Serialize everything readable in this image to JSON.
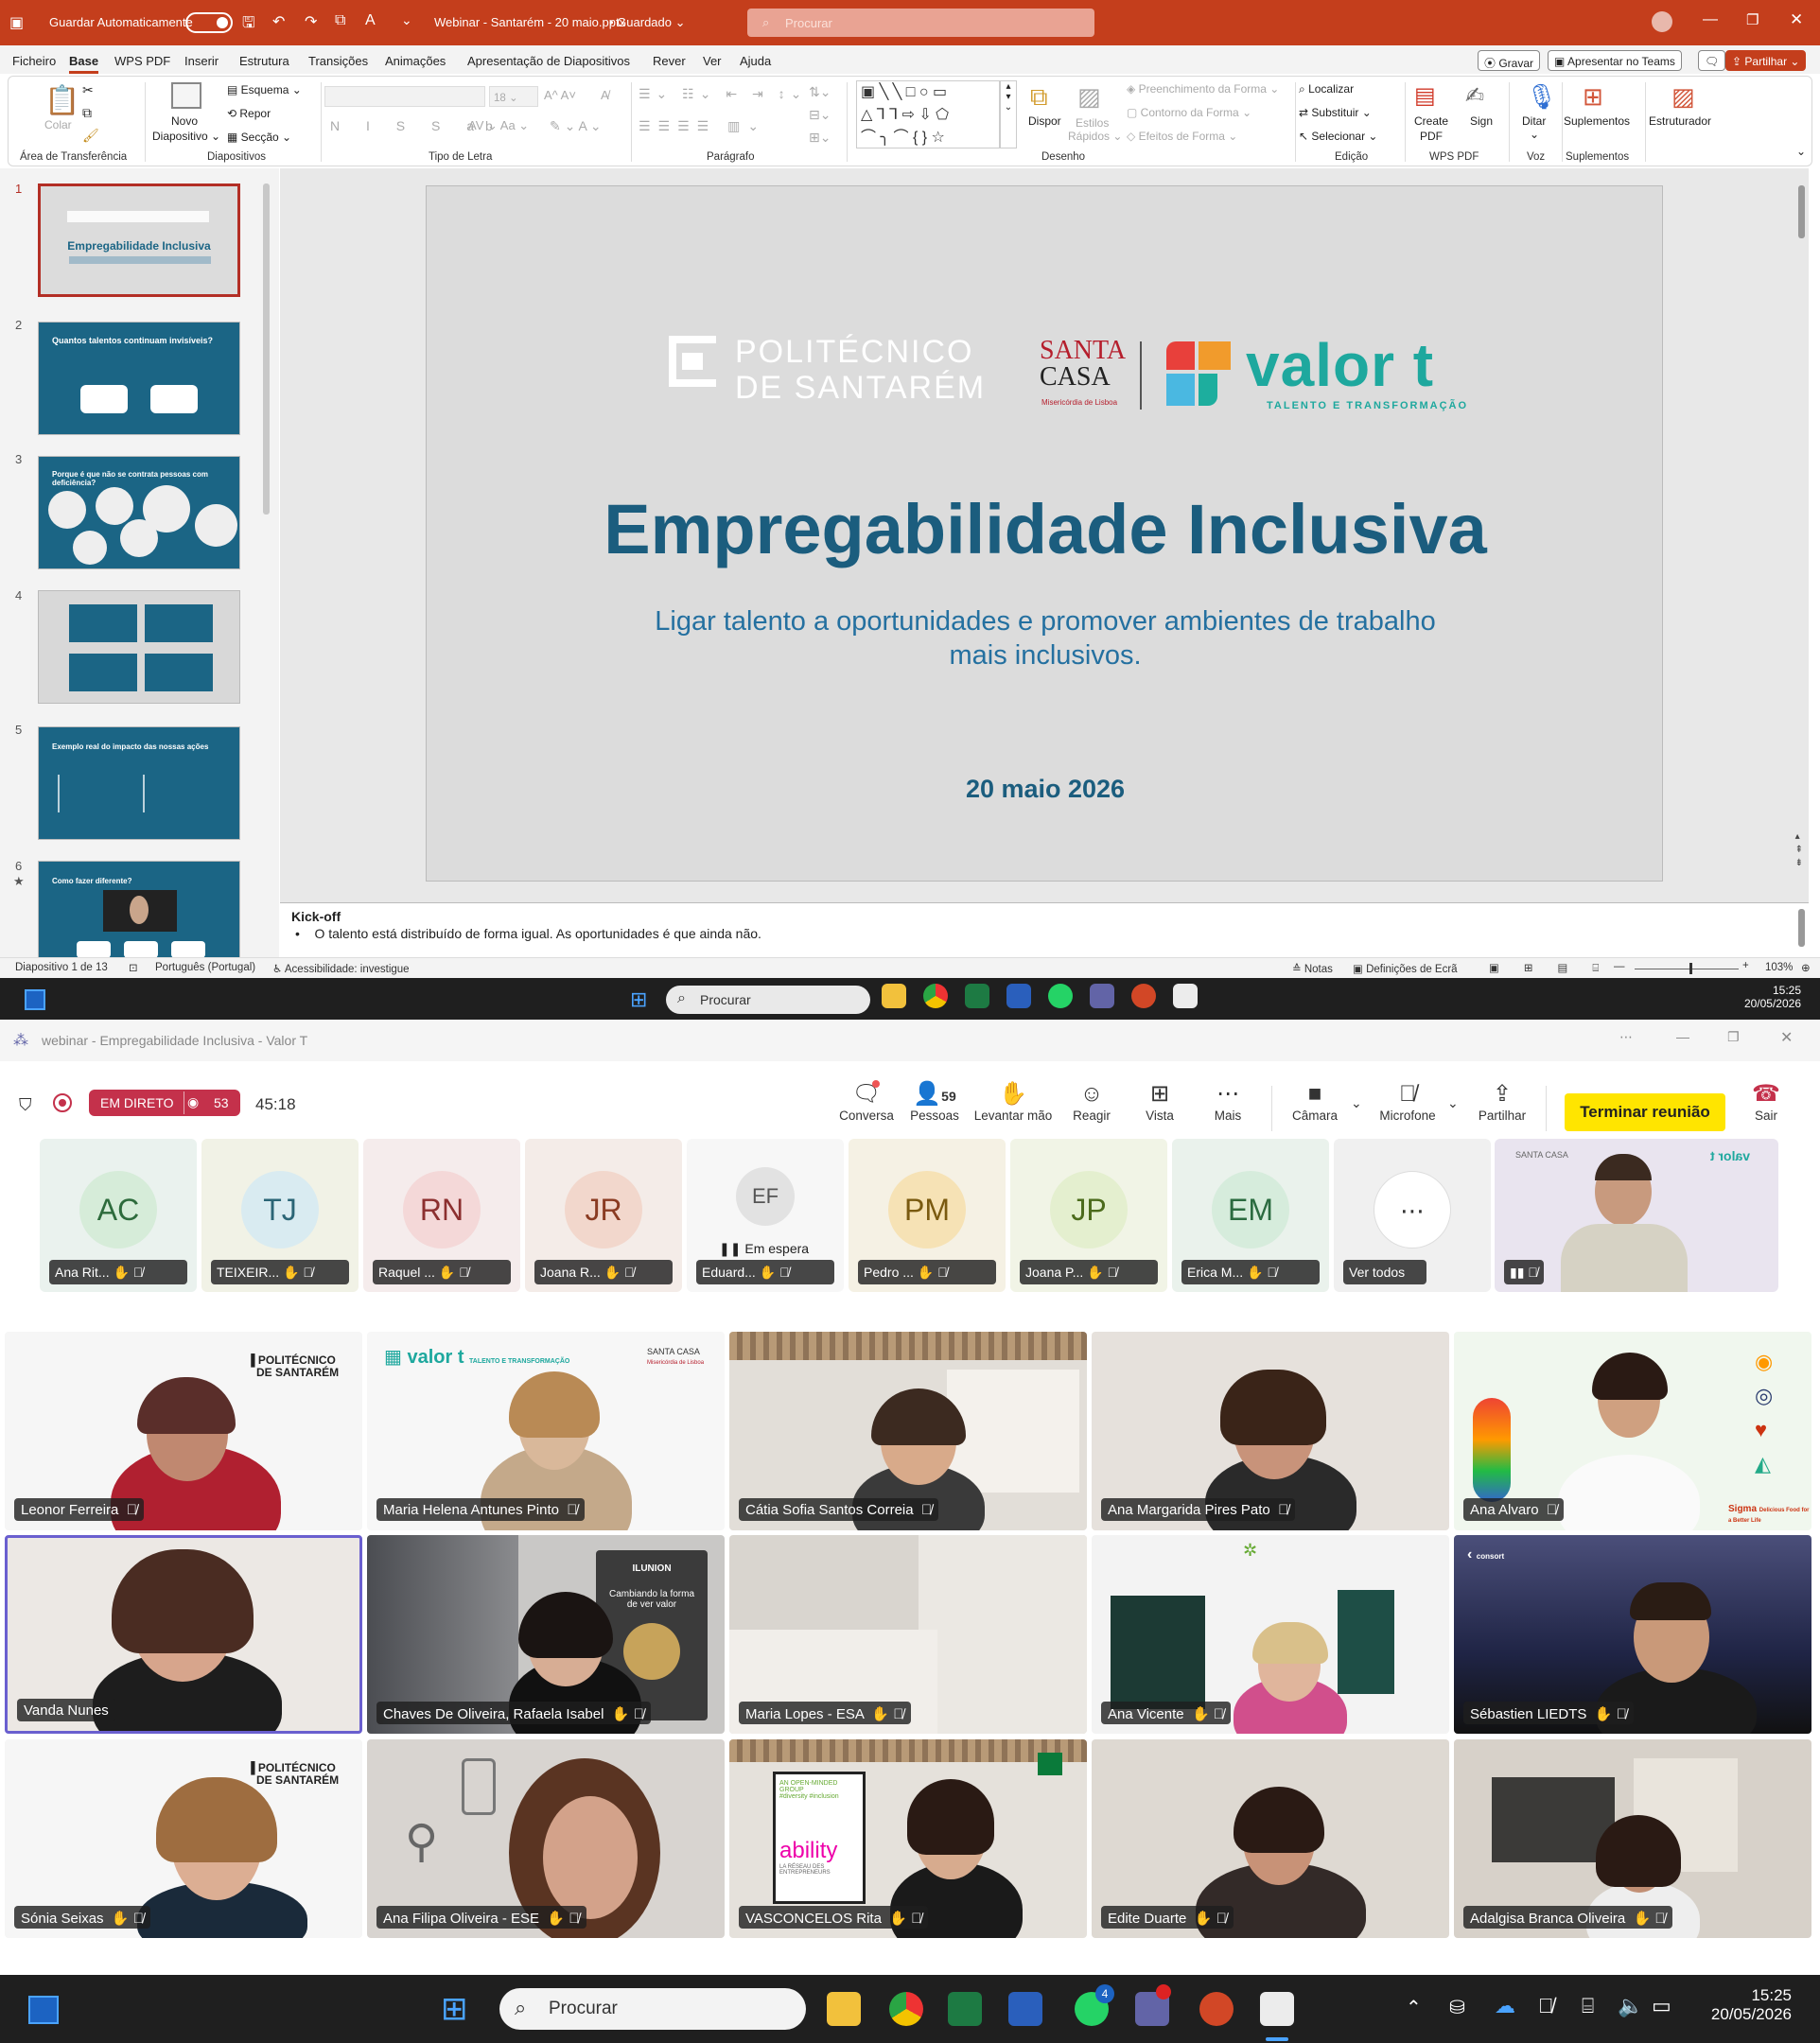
{
  "ppt": {
    "autosave_label": "Guardar Automaticamente",
    "doc_title": "Webinar - Santarém - 20 maio.pptx",
    "saved_state": "Guardado",
    "search_placeholder": "Procurar",
    "menu": [
      "Ficheiro",
      "Base",
      "WPS PDF",
      "Inserir",
      "Estrutura",
      "Transições",
      "Animações",
      "Apresentação de Diapositivos",
      "Rever",
      "Ver",
      "Ajuda"
    ],
    "record_btn": "Gravar",
    "teams_btn": "Apresentar no Teams",
    "share_btn": "Partilhar",
    "ribbon": {
      "paste": "Colar",
      "clipboard": "Área de Transferência",
      "new_slide_1": "Novo",
      "new_slide_2": "Diapositivo",
      "layout": "Esquema",
      "reset": "Repor",
      "section": "Secção",
      "slides_group": "Diapositivos",
      "font_size": "18",
      "font_group": "Tipo de Letra",
      "paragraph_group": "Parágrafo",
      "arrange": "Dispor",
      "quick_styles_1": "Estilos",
      "quick_styles_2": "Rápidos",
      "shape_fill": "Preenchimento da Forma",
      "shape_outline": "Contorno da Forma",
      "shape_effects": "Efeitos de Forma",
      "drawing_group": "Desenho",
      "find": "Localizar",
      "replace": "Substituir",
      "select": "Selecionar",
      "editing_group": "Edição",
      "create_pdf_1": "Create",
      "create_pdf_2": "PDF",
      "sign": "Sign",
      "wps_group": "WPS PDF",
      "dictate": "Ditar",
      "voice_group": "Voz",
      "addins": "Suplementos",
      "addins_group": "Suplementos",
      "designer": "Estruturador"
    },
    "slide": {
      "logo_left_1": "POLITÉCNICO",
      "logo_left_2": "DE SANTARÉM",
      "santa_1": "SANTA",
      "santa_2": "CASA",
      "santa_3": "Misericórdia de Lisboa",
      "valor": "valor t",
      "valor_sub": "TALENTO E TRANSFORMAÇÃO",
      "title": "Empregabilidade Inclusiva",
      "subtitle_1": "Ligar talento a oportunidades e promover ambientes de trabalho",
      "subtitle_2": "mais inclusivos.",
      "date": "20 maio 2026"
    },
    "thumbs": [
      {
        "n": "1",
        "title": "Empregabilidade Inclusiva"
      },
      {
        "n": "2",
        "title": "Quantos talentos continuam invisíveis?"
      },
      {
        "n": "3",
        "title": "Porque é que não se contrata pessoas com deficiência?"
      },
      {
        "n": "4",
        "title": ""
      },
      {
        "n": "5",
        "title": "Exemplo real do impacto das nossas ações"
      },
      {
        "n": "6",
        "title": "Como fazer diferente?"
      }
    ],
    "notes_title": "Kick-off",
    "notes_body": "O talento está distribuído de forma igual. As oportunidades é que ainda não.",
    "status": {
      "slide": "Diapositivo 1 de 13",
      "lang": "Português (Portugal)",
      "access": "Acessibilidade: investigue",
      "notes": "Notas",
      "display": "Definições de Ecrã",
      "zoom": "103%"
    }
  },
  "taskbar1": {
    "search": "Procurar",
    "time": "15:25",
    "date": "20/05/2026"
  },
  "teams": {
    "window_title": "webinar - Empregabilidade Inclusiva - Valor T",
    "live": "EM DIRETO",
    "viewers": "53",
    "timer": "45:18",
    "toolbar": {
      "chat": "Conversa",
      "people": "Pessoas",
      "people_count": "59",
      "raise": "Levantar mão",
      "react": "Reagir",
      "view": "Vista",
      "more": "Mais",
      "camera": "Câmara",
      "mic": "Microfone",
      "share": "Partilhar",
      "end": "Terminar reunião",
      "leave": "Sair"
    },
    "strip": [
      {
        "init": "AC",
        "name": "Ana Rit...",
        "color": "#dfeee4"
      },
      {
        "init": "TJ",
        "name": "TEIXEIR...",
        "color": "#e4eef2"
      },
      {
        "init": "RN",
        "name": "Raquel ...",
        "color": "#f6e1e1"
      },
      {
        "init": "JR",
        "name": "Joana R...",
        "color": "#f4e2da"
      },
      {
        "init": "EF",
        "name": "Eduard...",
        "color": "#e6e6e6",
        "waiting": "Em espera"
      },
      {
        "init": "PM",
        "name": "Pedro ...",
        "color": "#f7ecd0"
      },
      {
        "init": "JP",
        "name": "Joana P...",
        "color": "#eef3dc"
      },
      {
        "init": "EM",
        "name": "Erica M...",
        "color": "#e0efe4"
      }
    ],
    "see_all": "Ver todos",
    "grid": [
      "Leonor Ferreira",
      "Maria Helena Antunes Pinto",
      "Cátia Sofia Santos Correia",
      "Ana Margarida Pires Pato",
      "Ana Alvaro",
      "Vanda Nunes",
      "Chaves De Oliveira, Rafaela Isabel",
      "Maria Lopes - ESA",
      "Ana Vicente",
      "Sébastien LIEDTS",
      "Sónia Seixas",
      "Ana Filipa Oliveira - ESE",
      "VASCONCELOS Rita",
      "Edite Duarte",
      "Adalgisa Branca Oliveira"
    ],
    "bg_text": {
      "poli_1": "POLITÉCNICO",
      "poli_2": "DE SANTARÉM",
      "valor": "valor t",
      "valor_sub": "TALENTO E TRANSFORMAÇÃO",
      "santa": "SANTA CASA",
      "santa_sub": "Misericórdia de Lisboa",
      "ilunion": "ILUNION",
      "ilunion_1": "Cambiando la forma",
      "ilunion_2": "de ver valor",
      "ability_1": "AN OPEN-MINDED GROUP",
      "ability_2": "#diversity #inclusion",
      "ability": "ability",
      "ability_3": "LA RÉSEAU DES ENTREPRENEURS",
      "sigma": "Sigma",
      "sigma_tag": "Delicious Food for a Better Life",
      "consort": "consort"
    }
  },
  "taskbar2": {
    "search": "Procurar",
    "time": "15:25",
    "date": "20/05/2026",
    "teams_badge": "4"
  }
}
